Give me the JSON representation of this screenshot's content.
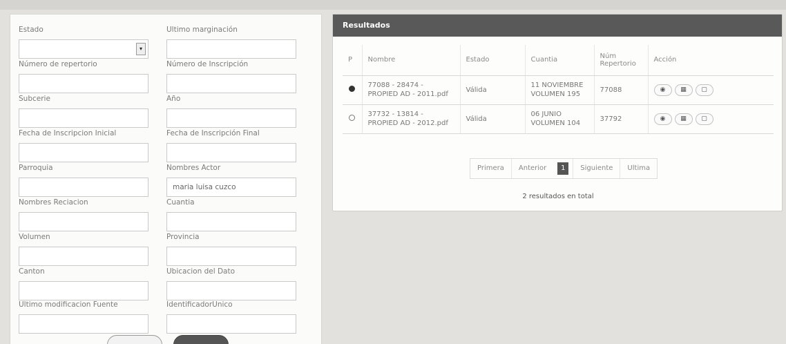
{
  "form": {
    "fields": [
      {
        "label": "Estado",
        "value": ""
      },
      {
        "label": "Ultimo marginación",
        "value": ""
      },
      {
        "label": "Número de repertorio",
        "value": ""
      },
      {
        "label": "Número de Inscripción",
        "value": ""
      },
      {
        "label": "Subcerie",
        "value": ""
      },
      {
        "label": "Año",
        "value": ""
      },
      {
        "label": "Fecha de Inscripcion Inicial",
        "value": ""
      },
      {
        "label": "Fecha de Inscripción Final",
        "value": ""
      },
      {
        "label": "Parroquia",
        "value": ""
      },
      {
        "label": "Nombres Actor",
        "value": "maria luisa cuzco"
      },
      {
        "label": "Nombres Reciacion",
        "value": ""
      },
      {
        "label": "Cuantia",
        "value": ""
      },
      {
        "label": "Volumen",
        "value": ""
      },
      {
        "label": "Provincia",
        "value": ""
      },
      {
        "label": "Canton",
        "value": ""
      },
      {
        "label": "Ubicacion del Dato",
        "value": ""
      },
      {
        "label": "Ultimo modificacion Fuente",
        "value": ""
      },
      {
        "label": "IdentificadorUnico",
        "value": ""
      }
    ]
  },
  "results": {
    "title": "Resultados",
    "columns": [
      "P",
      "Nombre",
      "Estado",
      "Cuantia",
      "Núm Repertorio",
      "Acción"
    ],
    "rows": [
      {
        "name": "77088 - 28474 - PROPIED AD - 2011.pdf",
        "estado": "Válida",
        "cuantia": "11 NOVIEMBRE VOLUMEN 195",
        "repertorio": "77088",
        "selected": true
      },
      {
        "name": "37732 - 13814 - PROPIED AD - 2012.pdf",
        "estado": "Válida",
        "cuantia": "06 JUNIO VOLUMEN 104",
        "repertorio": "37792",
        "selected": false
      }
    ],
    "pagination": {
      "first": "Primera",
      "prev": "Anterior",
      "current": "1",
      "next": "Siguiente",
      "last": "Ultima"
    },
    "total": "2 resultados en total",
    "action_icons": [
      "eye-icon",
      "calendar-icon",
      "document-icon"
    ]
  }
}
